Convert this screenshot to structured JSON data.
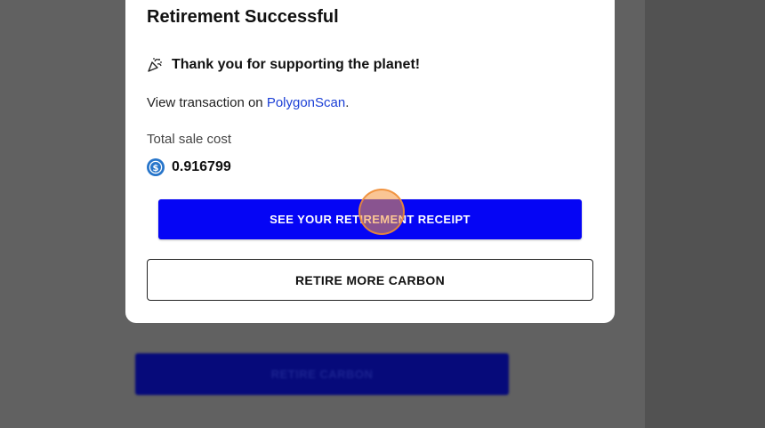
{
  "modal": {
    "title": "Retirement Successful",
    "thanks_text": "Thank you for supporting the planet!",
    "view_prefix": "View transaction on ",
    "view_link": "PolygonScan",
    "view_suffix": ".",
    "cost_label": "Total sale cost",
    "cost_value": "0.916799",
    "cost_token_icon": "usdc-coin-icon",
    "primary_button": "SEE YOUR RETIREMENT RECEIPT",
    "secondary_button": "RETIRE MORE CARBON"
  },
  "background": {
    "retire_button_label": "RETIRE CARBON"
  },
  "colors": {
    "primary": "#0505f5",
    "link": "#1b3fd6",
    "overlay": "#616161"
  }
}
